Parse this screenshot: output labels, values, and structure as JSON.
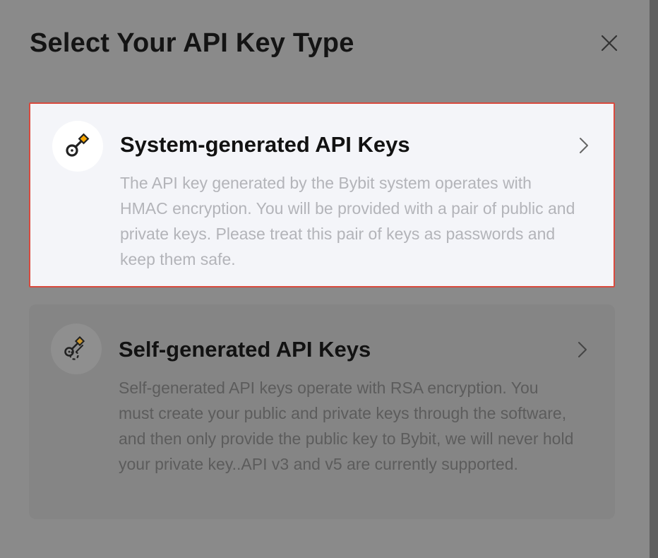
{
  "modal": {
    "title": "Select Your API Key Type",
    "close_icon": "close-icon"
  },
  "options": [
    {
      "title": "System-generated API Keys",
      "description": "The API key generated by the Bybit system operates with HMAC encryption. You will be provided with a pair of public and private keys. Please treat this pair of keys as passwords and keep them safe.",
      "icon": "key-icon",
      "selected": true
    },
    {
      "title": "Self-generated API Keys",
      "description": "Self-generated API keys operate with RSA encryption. You must create your public and private keys through the software, and then only provide the public key to Bybit, we will never hold your private key..API v3 and v5 are currently supported.",
      "icon": "key-pair-icon",
      "selected": false
    }
  ],
  "colors": {
    "overlay": "#8a8a8a",
    "selected_border": "#d94a3e",
    "accent": "#f7a600",
    "card_selected_bg": "#f4f5f9"
  }
}
